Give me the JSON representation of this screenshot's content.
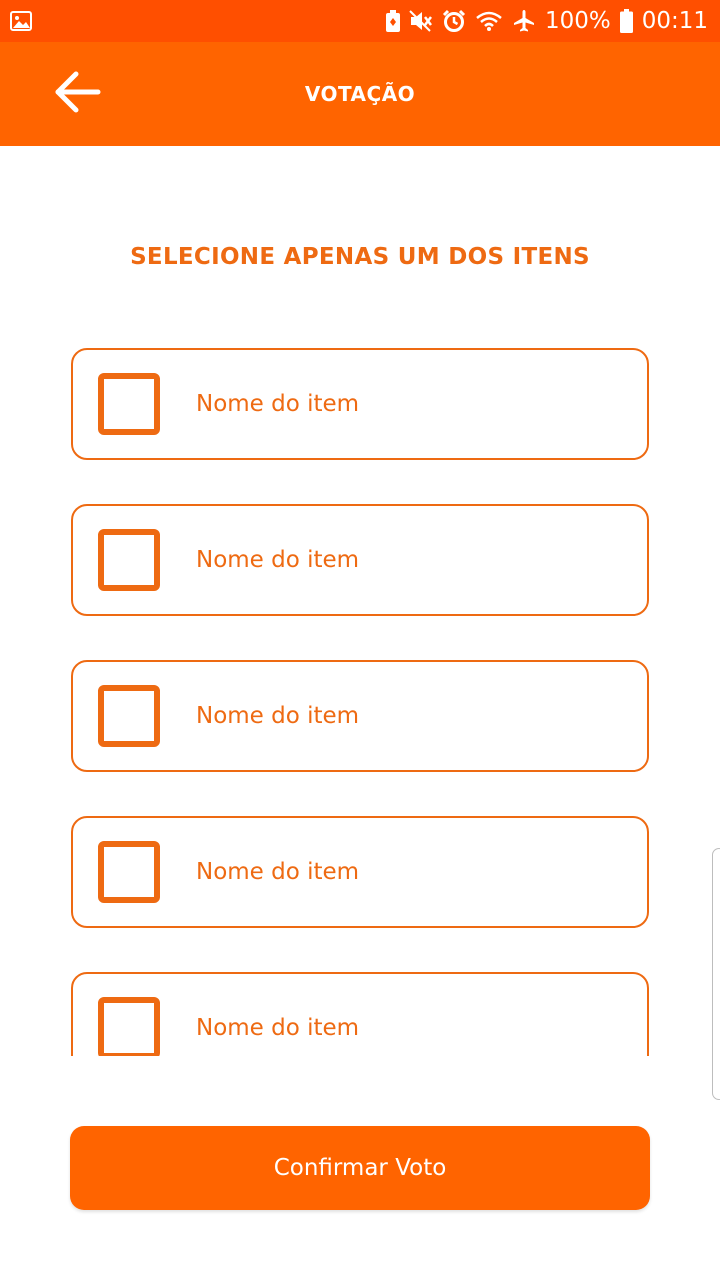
{
  "colors": {
    "status_bar": "#FF4F00",
    "app_bar": "#FF6400",
    "accent": "#EE6A12",
    "background": "#FFFFFF",
    "button": "#FF6400",
    "button_text": "#FFFFFF"
  },
  "status_bar": {
    "icons_left": [
      "image-icon"
    ],
    "icons_right": [
      "battery-saver-icon",
      "mute-icon",
      "alarm-icon",
      "wifi-icon",
      "airplane-icon",
      "battery-icon"
    ],
    "battery_percent": "100%",
    "time": "00:11"
  },
  "app_bar": {
    "back_icon": "arrow-left-icon",
    "title": "VOTAÇÃO"
  },
  "instruction": "SELECIONE APENAS UM DOS ITENS",
  "items": [
    {
      "label": "Nome do item",
      "checked": false
    },
    {
      "label": "Nome do item",
      "checked": false
    },
    {
      "label": "Nome do item",
      "checked": false
    },
    {
      "label": "Nome do item",
      "checked": false
    },
    {
      "label": "Nome do item",
      "checked": false
    }
  ],
  "confirm_button": {
    "label": "Confirmar Voto"
  }
}
